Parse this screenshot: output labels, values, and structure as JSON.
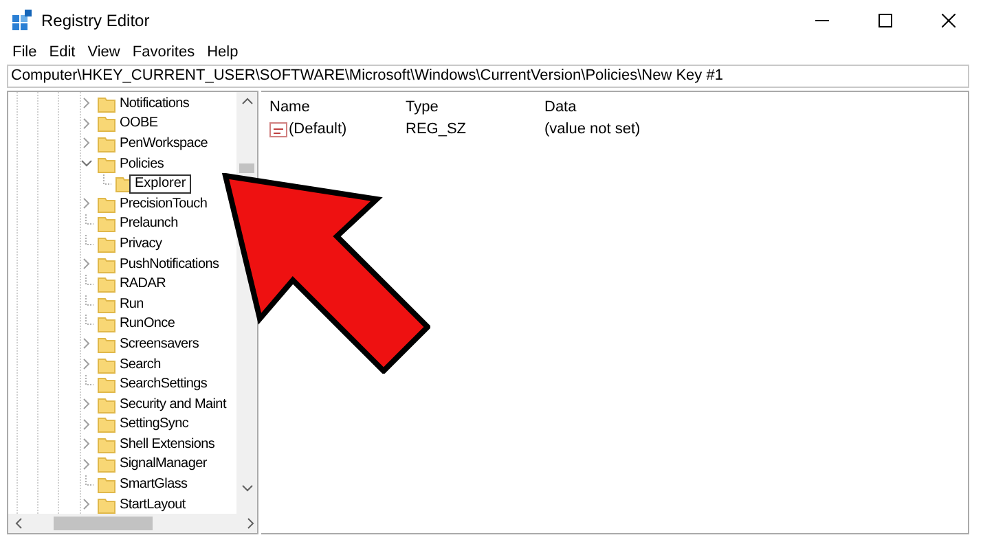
{
  "window": {
    "title": "Registry Editor"
  },
  "menu": [
    "File",
    "Edit",
    "View",
    "Favorites",
    "Help"
  ],
  "address": "Computer\\HKEY_CURRENT_USER\\SOFTWARE\\Microsoft\\Windows\\CurrentVersion\\Policies\\New Key #1",
  "tree": [
    {
      "label": "Notifications",
      "kind": "branch",
      "expanded": false
    },
    {
      "label": "OOBE",
      "kind": "branch",
      "expanded": false
    },
    {
      "label": "PenWorkspace",
      "kind": "branch",
      "expanded": false
    },
    {
      "label": "Policies",
      "kind": "branch",
      "expanded": true,
      "children": [
        {
          "label": "Explorer",
          "kind": "leaf",
          "editing": true
        }
      ]
    },
    {
      "label": "PrecisionTouch",
      "kind": "branch",
      "expanded": false
    },
    {
      "label": "Prelaunch",
      "kind": "leaf"
    },
    {
      "label": "Privacy",
      "kind": "leaf"
    },
    {
      "label": "PushNotifications",
      "kind": "branch",
      "expanded": false
    },
    {
      "label": "RADAR",
      "kind": "leaf"
    },
    {
      "label": "Run",
      "kind": "leaf"
    },
    {
      "label": "RunOnce",
      "kind": "leaf"
    },
    {
      "label": "Screensavers",
      "kind": "branch",
      "expanded": false
    },
    {
      "label": "Search",
      "kind": "branch",
      "expanded": false
    },
    {
      "label": "SearchSettings",
      "kind": "leaf"
    },
    {
      "label": "Security and Maint",
      "kind": "branch",
      "expanded": false
    },
    {
      "label": "SettingSync",
      "kind": "branch",
      "expanded": false
    },
    {
      "label": "Shell Extensions",
      "kind": "branch",
      "expanded": false
    },
    {
      "label": "SignalManager",
      "kind": "branch",
      "expanded": false
    },
    {
      "label": "SmartGlass",
      "kind": "leaf"
    },
    {
      "label": "StartLayout",
      "kind": "branch",
      "expanded": false
    }
  ],
  "table": {
    "columns": [
      "Name",
      "Type",
      "Data"
    ],
    "rows": [
      {
        "name": "(Default)",
        "type": "REG_SZ",
        "data": "(value not set)"
      }
    ]
  }
}
